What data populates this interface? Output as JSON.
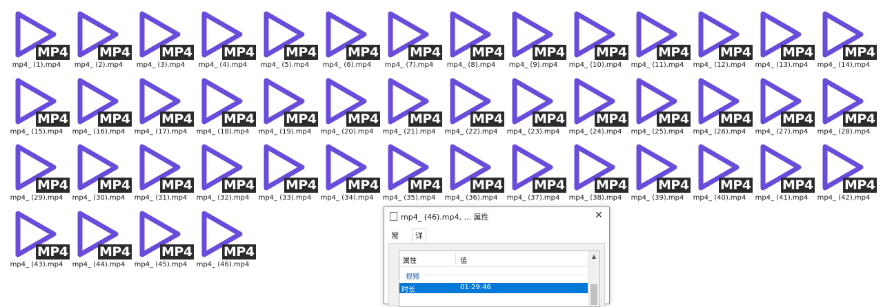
{
  "icon_badge": "MP4",
  "accent_color": "#6a4cdb",
  "files": [
    "mp4_ (1).mp4",
    "mp4_ (2).mp4",
    "mp4_ (3).mp4",
    "mp4_ (4).mp4",
    "mp4_ (5).mp4",
    "mp4_ (6).mp4",
    "mp4_ (7).mp4",
    "mp4_ (8).mp4",
    "mp4_ (9).mp4",
    "mp4_ (10).mp4",
    "mp4_ (11).mp4",
    "mp4_ (12).mp4",
    "mp4_ (13).mp4",
    "mp4_ (14).mp4",
    "mp4_ (15).mp4",
    "mp4_ (16).mp4",
    "mp4_ (17).mp4",
    "mp4_ (18).mp4",
    "mp4_ (19).mp4",
    "mp4_ (20).mp4",
    "mp4_ (21).mp4",
    "mp4_ (22).mp4",
    "mp4_ (23).mp4",
    "mp4_ (24).mp4",
    "mp4_ (25).mp4",
    "mp4_ (26).mp4",
    "mp4_ (27).mp4",
    "mp4_ (28).mp4",
    "mp4_ (29).mp4",
    "mp4_ (30).mp4",
    "mp4_ (31).mp4",
    "mp4_ (32).mp4",
    "mp4_ (33).mp4",
    "mp4_ (34).mp4",
    "mp4_ (35).mp4",
    "mp4_ (36).mp4",
    "mp4_ (37).mp4",
    "mp4_ (38).mp4",
    "mp4_ (39).mp4",
    "mp4_ (40).mp4",
    "mp4_ (41).mp4",
    "mp4_ (42).mp4",
    "mp4_ (43).mp4",
    "mp4_ (44).mp4",
    "mp4_ (45).mp4",
    "mp4_ (46).mp4"
  ],
  "dialog": {
    "title": "mp4_ (46).mp4, ... 属性",
    "close_glyph": "✕",
    "tabs": [
      "常规",
      "详细信息"
    ],
    "active_tab": "详细信息",
    "list": {
      "header_property": "属性",
      "header_value": "值",
      "group": "视频",
      "selected_row": {
        "property": "时长",
        "value": "01:29:46"
      }
    }
  }
}
